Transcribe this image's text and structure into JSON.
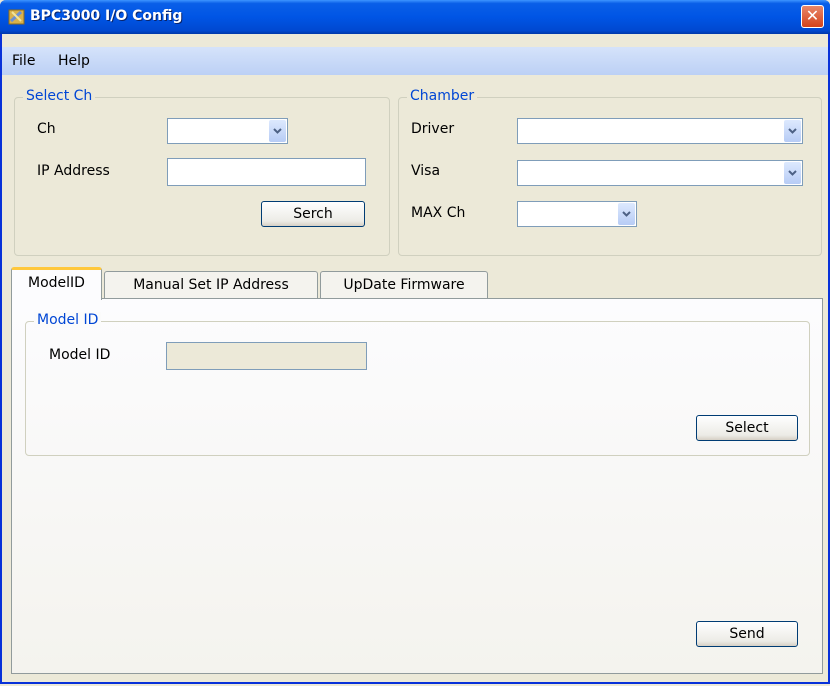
{
  "window": {
    "title": "BPC3000 I/O Config",
    "close_glyph": "✕"
  },
  "menu": {
    "items": [
      "File",
      "Help"
    ]
  },
  "select_ch": {
    "legend": "Select Ch",
    "ch_label": "Ch",
    "ch_value": "",
    "ip_label": "IP Address",
    "ip_value": "",
    "search_button": "Serch"
  },
  "chamber": {
    "legend": "Chamber",
    "driver_label": "Driver",
    "driver_value": "",
    "visa_label": "Visa",
    "visa_value": "",
    "maxch_label": "MAX Ch",
    "maxch_value": ""
  },
  "tabs": [
    {
      "label": "ModelID",
      "active": true
    },
    {
      "label": "Manual Set IP Address",
      "active": false
    },
    {
      "label": "UpDate Firmware",
      "active": false
    }
  ],
  "model_id": {
    "legend": "Model ID",
    "label": "Model ID",
    "value": "",
    "select_button": "Select"
  },
  "send_button": "Send",
  "colors": {
    "title_bar": "#0055E5",
    "legend_text": "#0046D5",
    "close_button": "#D4421A",
    "active_tab_accent": "#FFC83C"
  }
}
